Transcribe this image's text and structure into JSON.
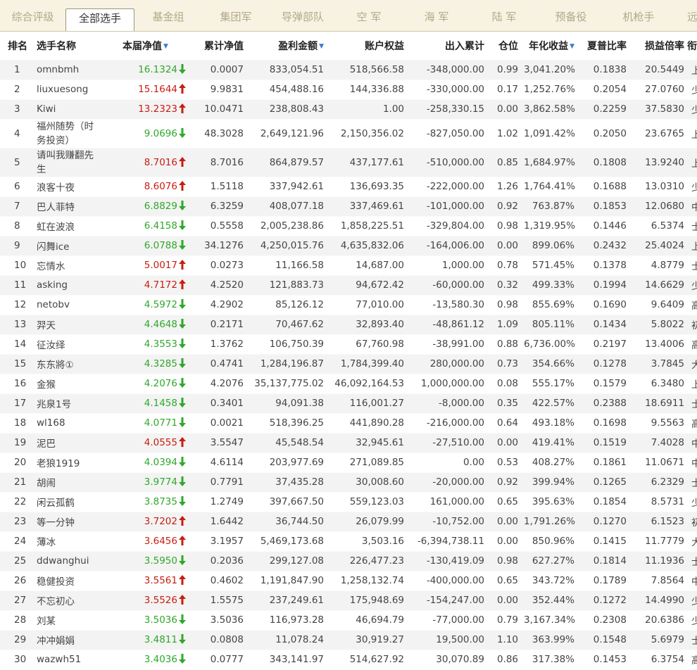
{
  "tabs": [
    "综合评级",
    "全部选手",
    "基金组",
    "集团军",
    "导弹部队",
    "空 军",
    "海 军",
    "陆 军",
    "预备役",
    "机枪手",
    "远"
  ],
  "active_tab": "全部选手",
  "colors": {
    "up": "#c81d11",
    "down": "#2ea82a",
    "sort_arrow": "#3a7ecb",
    "tab_bg": "#f7f2e1"
  },
  "headers": {
    "rank": "排名",
    "name": "选手名称",
    "nav": "本届净值",
    "cum_nav": "累计净值",
    "profit": "盈利金额",
    "equity": "账户权益",
    "inout": "出入累计",
    "position": "仓位",
    "annual": "年化收益",
    "sharpe": "夏普比率",
    "ratio": "损益倍率",
    "title": "衔级"
  },
  "sort_arrow_icon": "▼",
  "rows": [
    {
      "rank": "1",
      "name": "omnbmh",
      "nav": "16.1324",
      "dir": "down",
      "cum_nav": "0.0007",
      "profit": "833,054.51",
      "equity": "518,566.58",
      "inout": "-348,000.00",
      "position": "0.99",
      "annual": "3,041.20%",
      "sharpe": "0.1838",
      "ratio": "20.5449",
      "title": "上尉"
    },
    {
      "rank": "2",
      "name": "liuxuesong",
      "nav": "15.1644",
      "dir": "up",
      "cum_nav": "9.9831",
      "profit": "454,488.16",
      "equity": "144,336.88",
      "inout": "-330,000.00",
      "position": "0.17",
      "annual": "1,252.76%",
      "sharpe": "0.2054",
      "ratio": "27.0760",
      "title": "少尉"
    },
    {
      "rank": "3",
      "name": "Kiwi",
      "nav": "13.2323",
      "dir": "up",
      "cum_nav": "10.0471",
      "profit": "238,808.43",
      "equity": "1.00",
      "inout": "-258,330.15",
      "position": "0.00",
      "annual": "3,862.58%",
      "sharpe": "0.2259",
      "ratio": "37.5830",
      "title": "少尉"
    },
    {
      "rank": "4",
      "name": "福州随势（时务投资）",
      "nav": "9.0696",
      "dir": "down",
      "cum_nav": "48.3028",
      "profit": "2,649,121.96",
      "equity": "2,150,356.02",
      "inout": "-827,050.00",
      "position": "1.02",
      "annual": "1,091.42%",
      "sharpe": "0.2050",
      "ratio": "23.6765",
      "title": "上校",
      "tall": true
    },
    {
      "rank": "5",
      "name": "请叫我赚翻先生",
      "nav": "8.7016",
      "dir": "up",
      "cum_nav": "8.7016",
      "profit": "864,879.57",
      "equity": "437,177.61",
      "inout": "-510,000.00",
      "position": "0.85",
      "annual": "1,684.97%",
      "sharpe": "0.1808",
      "ratio": "13.9240",
      "title": "上尉",
      "tall": true
    },
    {
      "rank": "6",
      "name": "浪客十夜",
      "nav": "8.6076",
      "dir": "up",
      "cum_nav": "1.5118",
      "profit": "337,942.61",
      "equity": "136,693.35",
      "inout": "-222,000.00",
      "position": "1.26",
      "annual": "1,764.41%",
      "sharpe": "0.1688",
      "ratio": "13.0310",
      "title": "少尉"
    },
    {
      "rank": "7",
      "name": "巴人菲特",
      "nav": "6.8829",
      "dir": "down",
      "cum_nav": "6.3259",
      "profit": "408,077.18",
      "equity": "337,469.61",
      "inout": "-101,000.00",
      "position": "0.92",
      "annual": "763.87%",
      "sharpe": "0.1853",
      "ratio": "12.0680",
      "title": "中尉"
    },
    {
      "rank": "8",
      "name": "虹在波浪",
      "nav": "6.4158",
      "dir": "down",
      "cum_nav": "0.5558",
      "profit": "2,005,238.86",
      "equity": "1,858,225.51",
      "inout": "-329,804.00",
      "position": "0.98",
      "annual": "1,319.95%",
      "sharpe": "0.1446",
      "ratio": "6.5374",
      "title": "士兵"
    },
    {
      "rank": "9",
      "name": "闪舞ice",
      "nav": "6.0788",
      "dir": "down",
      "cum_nav": "34.1276",
      "profit": "4,250,015.76",
      "equity": "4,635,832.06",
      "inout": "-164,006.00",
      "position": "0.00",
      "annual": "899.06%",
      "sharpe": "0.2432",
      "ratio": "25.4024",
      "title": "上校"
    },
    {
      "rank": "10",
      "name": "忘情水",
      "nav": "5.0017",
      "dir": "up",
      "cum_nav": "0.0273",
      "profit": "11,166.58",
      "equity": "14,687.00",
      "inout": "1,000.00",
      "position": "0.78",
      "annual": "571.45%",
      "sharpe": "0.1378",
      "ratio": "4.8779",
      "title": "士兵"
    },
    {
      "rank": "11",
      "name": "asking",
      "nav": "4.7172",
      "dir": "up",
      "cum_nav": "4.2520",
      "profit": "121,883.73",
      "equity": "94,672.42",
      "inout": "-60,000.00",
      "position": "0.32",
      "annual": "499.33%",
      "sharpe": "0.1994",
      "ratio": "14.6629",
      "title": "少尉"
    },
    {
      "rank": "12",
      "name": "netobv",
      "nav": "4.5972",
      "dir": "down",
      "cum_nav": "4.2902",
      "profit": "85,126.12",
      "equity": "77,010.00",
      "inout": "-13,580.30",
      "position": "0.98",
      "annual": "855.69%",
      "sharpe": "0.1690",
      "ratio": "9.6409",
      "title": "高级士官"
    },
    {
      "rank": "13",
      "name": "羿天",
      "nav": "4.4648",
      "dir": "down",
      "cum_nav": "0.2171",
      "profit": "70,467.62",
      "equity": "32,893.40",
      "inout": "-48,861.12",
      "position": "1.09",
      "annual": "805.11%",
      "sharpe": "0.1434",
      "ratio": "5.8022",
      "title": "初级士官"
    },
    {
      "rank": "14",
      "name": "征汝绎",
      "nav": "4.3553",
      "dir": "down",
      "cum_nav": "1.3762",
      "profit": "106,750.39",
      "equity": "67,760.98",
      "inout": "-38,991.00",
      "position": "0.88",
      "annual": "6,736.00%",
      "sharpe": "0.2197",
      "ratio": "13.4006",
      "title": "高级士官"
    },
    {
      "rank": "15",
      "name": "东东將①",
      "nav": "4.3285",
      "dir": "down",
      "cum_nav": "0.4741",
      "profit": "1,284,196.87",
      "equity": "1,784,399.40",
      "inout": "280,000.00",
      "position": "0.73",
      "annual": "354.66%",
      "sharpe": "0.1278",
      "ratio": "3.7845",
      "title": "大校"
    },
    {
      "rank": "16",
      "name": "金猴",
      "nav": "4.2076",
      "dir": "down",
      "cum_nav": "4.2076",
      "profit": "35,137,775.02",
      "equity": "46,092,164.53",
      "inout": "1,000,000.00",
      "position": "0.08",
      "annual": "555.17%",
      "sharpe": "0.1579",
      "ratio": "6.3480",
      "title": "上将"
    },
    {
      "rank": "17",
      "name": "兆泉1号",
      "nav": "4.1458",
      "dir": "down",
      "cum_nav": "0.3401",
      "profit": "94,091.38",
      "equity": "116,001.27",
      "inout": "-8,000.00",
      "position": "0.35",
      "annual": "422.57%",
      "sharpe": "0.2388",
      "ratio": "18.6911",
      "title": "士兵"
    },
    {
      "rank": "18",
      "name": "wl168",
      "nav": "4.0771",
      "dir": "down",
      "cum_nav": "0.0021",
      "profit": "518,396.25",
      "equity": "441,890.28",
      "inout": "-216,000.00",
      "position": "0.64",
      "annual": "493.18%",
      "sharpe": "0.1698",
      "ratio": "9.5563",
      "title": "高级士官"
    },
    {
      "rank": "19",
      "name": "泥巴",
      "nav": "4.0555",
      "dir": "up",
      "cum_nav": "3.5547",
      "profit": "45,548.54",
      "equity": "32,945.61",
      "inout": "-27,510.00",
      "position": "0.00",
      "annual": "419.41%",
      "sharpe": "0.1519",
      "ratio": "7.4028",
      "title": "中级士官"
    },
    {
      "rank": "20",
      "name": "老狼1919",
      "nav": "4.0394",
      "dir": "down",
      "cum_nav": "4.6114",
      "profit": "203,977.69",
      "equity": "271,089.85",
      "inout": "0.00",
      "position": "0.53",
      "annual": "408.27%",
      "sharpe": "0.1861",
      "ratio": "11.0671",
      "title": "中级士官"
    },
    {
      "rank": "21",
      "name": "胡闹",
      "nav": "3.9774",
      "dir": "down",
      "cum_nav": "0.7791",
      "profit": "37,435.28",
      "equity": "30,008.60",
      "inout": "-20,000.00",
      "position": "0.92",
      "annual": "399.94%",
      "sharpe": "0.1265",
      "ratio": "6.2329",
      "title": "士兵"
    },
    {
      "rank": "22",
      "name": "闲云孤鹤",
      "nav": "3.8735",
      "dir": "down",
      "cum_nav": "1.2749",
      "profit": "397,667.50",
      "equity": "559,123.03",
      "inout": "161,000.00",
      "position": "0.65",
      "annual": "395.63%",
      "sharpe": "0.1854",
      "ratio": "8.5731",
      "title": "少尉"
    },
    {
      "rank": "23",
      "name": "等一分钟",
      "nav": "3.7202",
      "dir": "up",
      "cum_nav": "1.6442",
      "profit": "36,744.50",
      "equity": "26,079.99",
      "inout": "-10,752.00",
      "position": "0.00",
      "annual": "1,791.26%",
      "sharpe": "0.1270",
      "ratio": "6.1523",
      "title": "初级士官"
    },
    {
      "rank": "24",
      "name": "薄冰",
      "nav": "3.6456",
      "dir": "up",
      "cum_nav": "3.1957",
      "profit": "5,469,173.68",
      "equity": "3,503.16",
      "inout": "-6,394,738.11",
      "position": "0.00",
      "annual": "850.96%",
      "sharpe": "0.1415",
      "ratio": "11.7779",
      "title": "大校"
    },
    {
      "rank": "25",
      "name": "ddwanghui",
      "nav": "3.5950",
      "dir": "down",
      "cum_nav": "0.2036",
      "profit": "299,127.08",
      "equity": "226,477.23",
      "inout": "-130,419.09",
      "position": "0.98",
      "annual": "627.27%",
      "sharpe": "0.1814",
      "ratio": "11.1936",
      "title": "士兵"
    },
    {
      "rank": "26",
      "name": "稳健投资",
      "nav": "3.5561",
      "dir": "up",
      "cum_nav": "0.4602",
      "profit": "1,191,847.90",
      "equity": "1,258,132.74",
      "inout": "-400,000.00",
      "position": "0.65",
      "annual": "343.72%",
      "sharpe": "0.1789",
      "ratio": "7.8564",
      "title": "中尉"
    },
    {
      "rank": "27",
      "name": "不忘初心",
      "nav": "3.5526",
      "dir": "up",
      "cum_nav": "1.5575",
      "profit": "237,249.61",
      "equity": "175,948.69",
      "inout": "-154,247.00",
      "position": "0.00",
      "annual": "352.44%",
      "sharpe": "0.1272",
      "ratio": "14.4990",
      "title": "少尉"
    },
    {
      "rank": "28",
      "name": "刘某",
      "nav": "3.5036",
      "dir": "down",
      "cum_nav": "3.5036",
      "profit": "116,973.28",
      "equity": "46,694.79",
      "inout": "-77,000.00",
      "position": "0.79",
      "annual": "3,167.34%",
      "sharpe": "0.2308",
      "ratio": "20.6386",
      "title": "少尉"
    },
    {
      "rank": "29",
      "name": "冲冲娟娟",
      "nav": "3.4811",
      "dir": "down",
      "cum_nav": "0.0808",
      "profit": "11,078.24",
      "equity": "30,919.27",
      "inout": "19,500.00",
      "position": "1.10",
      "annual": "363.99%",
      "sharpe": "0.1548",
      "ratio": "5.6979",
      "title": "士兵"
    },
    {
      "rank": "30",
      "name": "wazwh51",
      "nav": "3.4036",
      "dir": "down",
      "cum_nav": "0.0777",
      "profit": "343,141.97",
      "equity": "514,627.92",
      "inout": "30,070.89",
      "position": "0.86",
      "annual": "317.38%",
      "sharpe": "0.1453",
      "ratio": "6.3754",
      "title": "高级士官"
    }
  ]
}
